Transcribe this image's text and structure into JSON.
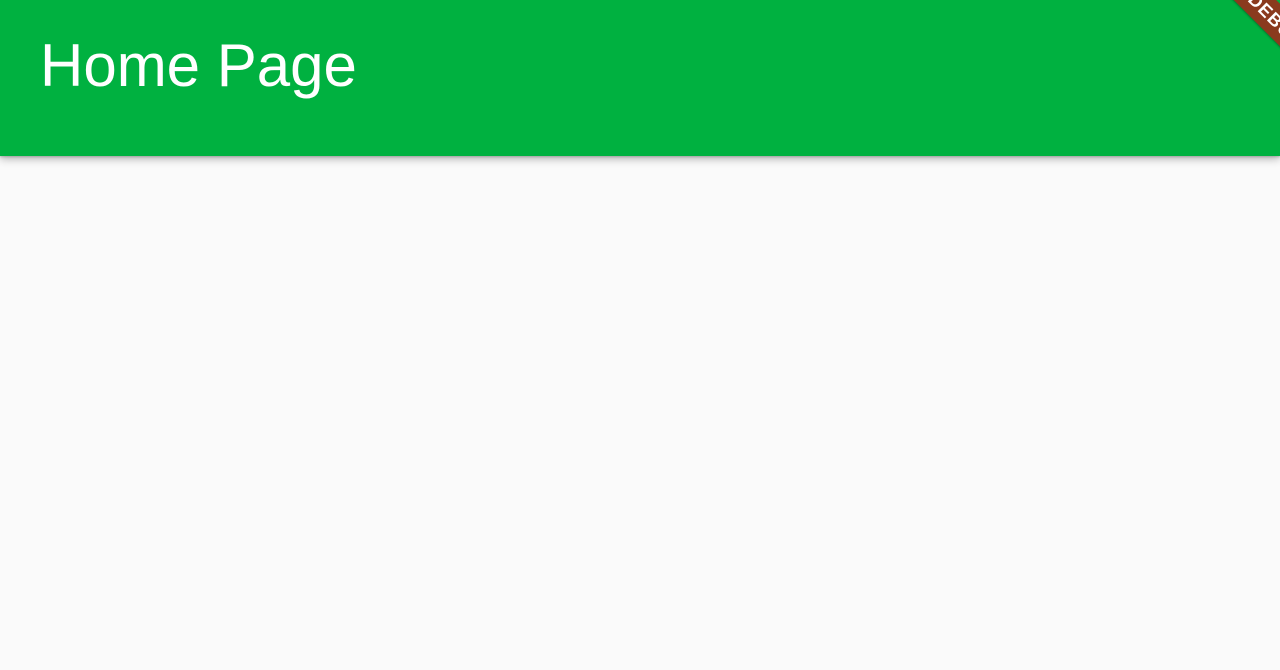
{
  "appbar": {
    "title": "Home Page",
    "color": "#00b140"
  },
  "debug_banner": {
    "label": "DEBUG",
    "color": "#8a3a1e"
  },
  "body": {
    "background": "#fafafa"
  }
}
